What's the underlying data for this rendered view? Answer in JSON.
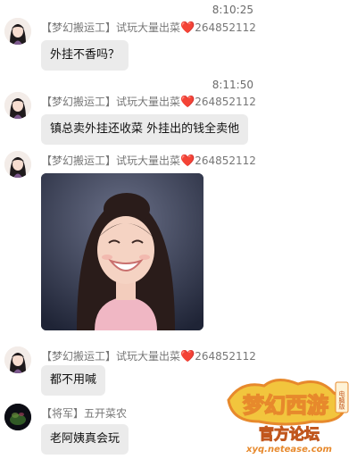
{
  "messages": [
    {
      "time": "8:10:25",
      "sender": "【梦幻搬运工】试玩大量出菜",
      "heart": "❤️",
      "qq": "264852112",
      "text": "外挂不香吗？"
    },
    {
      "time": "8:11:50",
      "sender": "【梦幻搬运工】试玩大量出菜",
      "heart": "❤️",
      "qq": "264852112",
      "text": "镇总卖外挂还收菜  外挂出的钱全卖他"
    },
    {
      "sender": "【梦幻搬运工】试玩大量出菜",
      "heart": "❤️",
      "qq": "264852112",
      "image": "smiling-woman-photo"
    },
    {
      "sender": "【梦幻搬运工】试玩大量出菜",
      "heart": "❤️",
      "qq": "264852112",
      "text": "都不用喊"
    },
    {
      "sender": "【将军】五开菜农",
      "text": "老阿姨真会玩"
    }
  ],
  "watermark": {
    "title": "梦幻西游",
    "badge": "电脑版",
    "sub_cn": "官方论坛",
    "url": "xyq.netease.com"
  },
  "colors": {
    "bubble": "#ebebeb",
    "heart": "#e0353a",
    "logo_gold": "#f2c53d",
    "logo_orange": "#e7892c"
  }
}
